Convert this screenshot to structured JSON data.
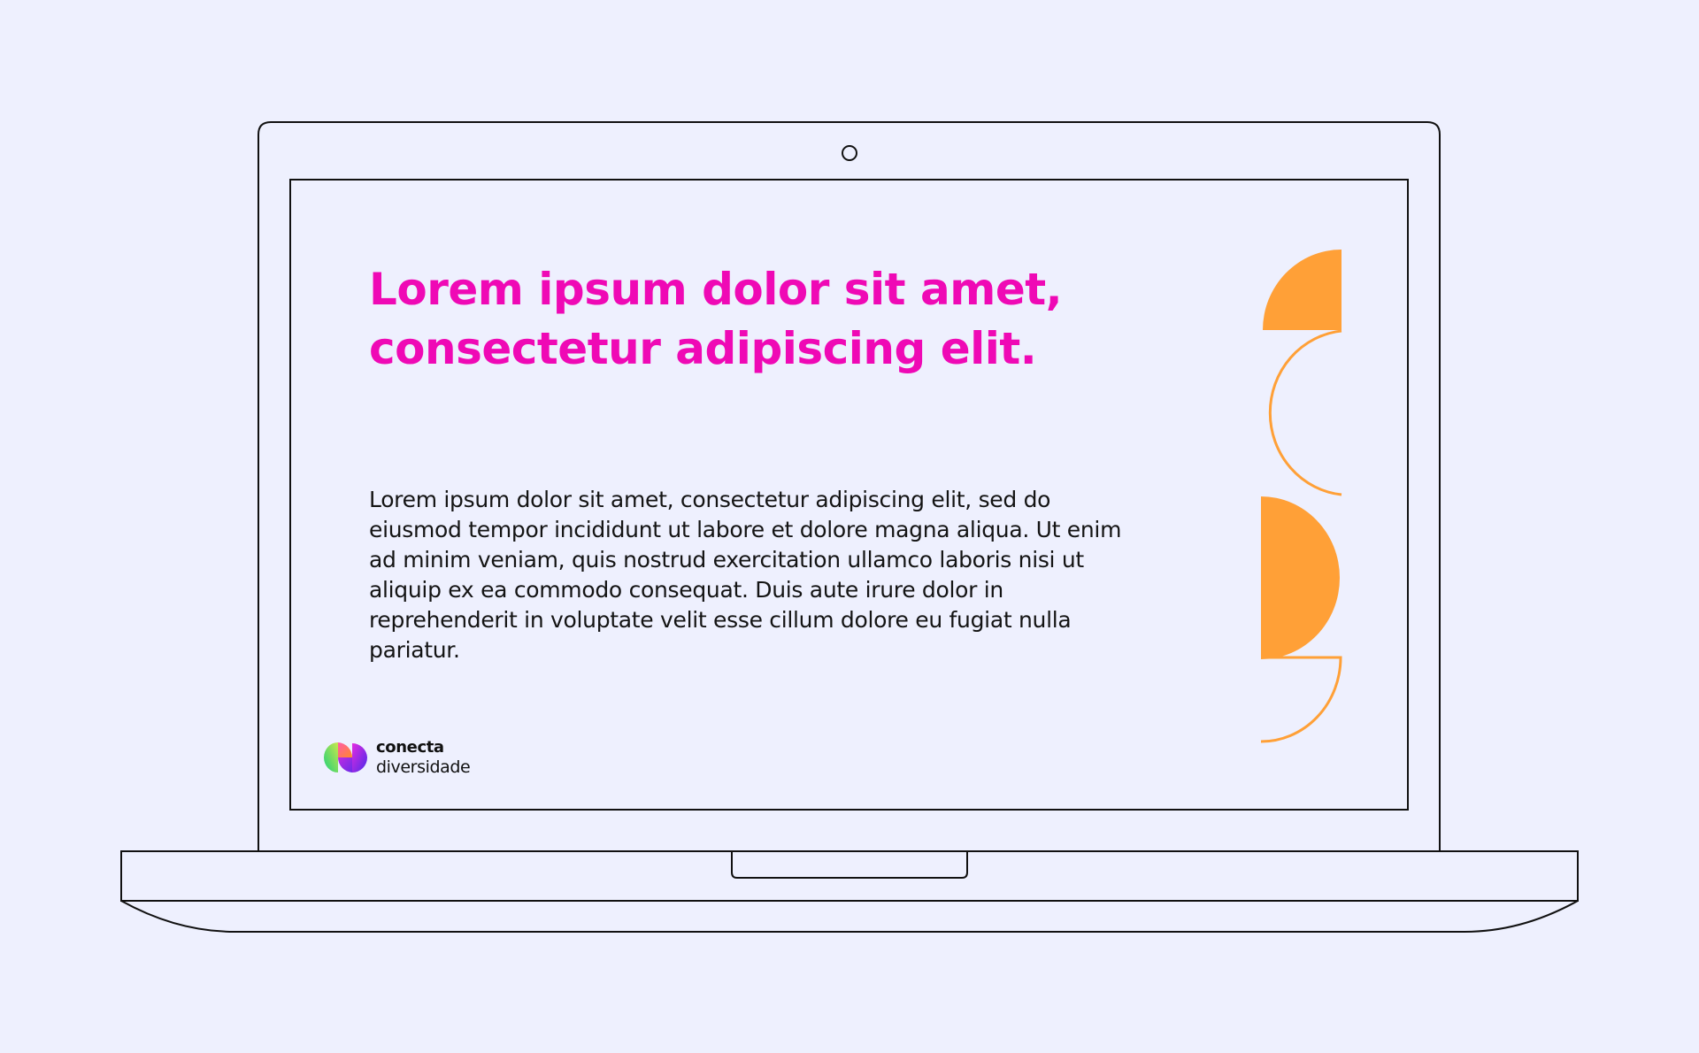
{
  "headline": {
    "line1": "Lorem ipsum dolor sit amet,",
    "line2": "consectetur adipiscing elit."
  },
  "body": {
    "lines": [
      "Lorem ipsum dolor sit amet, consectetur adipiscing elit, sed do",
      "eiusmod tempor incididunt ut labore et dolore magna aliqua. Ut enim",
      "ad minim veniam, quis nostrud exercitation ullamco laboris nisi ut",
      "aliquip ex ea commodo consequat. Duis aute irure dolor in",
      "reprehenderit in voluptate velit esse cillum dolore eu fugiat nulla",
      "pariatur."
    ]
  },
  "brand": {
    "name": "conecta",
    "tagline": "diversidade"
  },
  "colors": {
    "background": "#EEF0FE",
    "headline": "#EF09B5",
    "body_text": "#141414",
    "shapes": "#FFA037",
    "outline": "#111111"
  },
  "icons": {
    "logo": "conecta-logo-icon",
    "camera": "webcam-icon",
    "decoration": "orange-half-circle-shapes"
  }
}
